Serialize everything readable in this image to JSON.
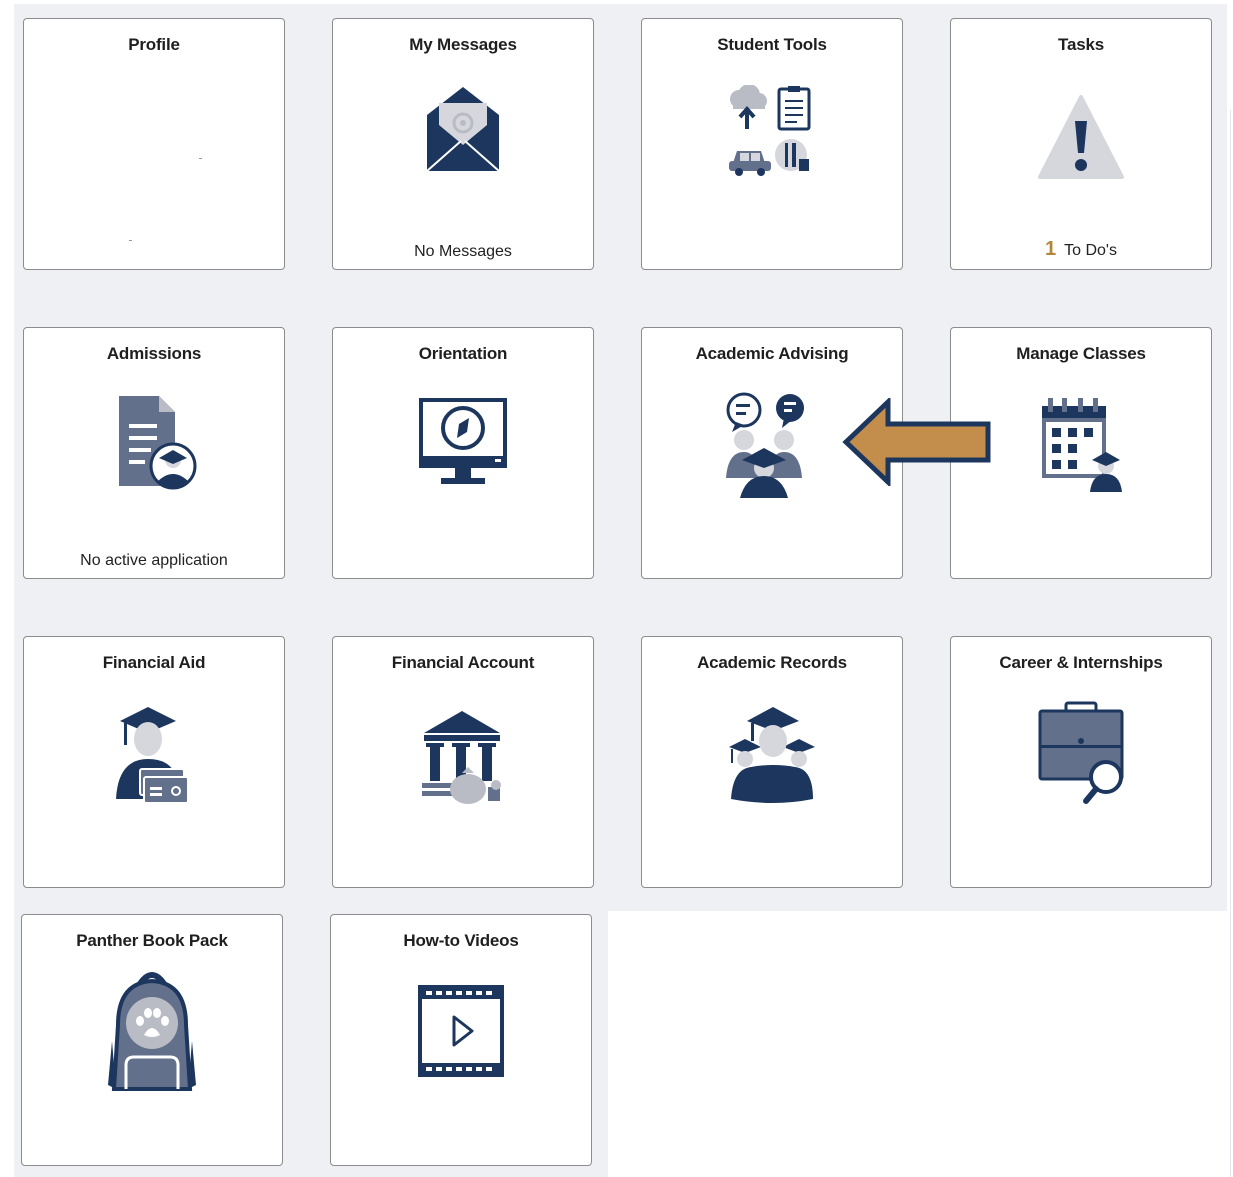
{
  "tiles": [
    {
      "title": "Profile",
      "footer": "",
      "icon": "profile-placeholder"
    },
    {
      "title": "My Messages",
      "footer": "No Messages",
      "icon": "envelope-icon"
    },
    {
      "title": "Student Tools",
      "footer": "",
      "icon": "student-tools-icon"
    },
    {
      "title": "Tasks",
      "count": "1",
      "footer": "To Do's",
      "icon": "warning-icon"
    },
    {
      "title": "Admissions",
      "footer": "No active application",
      "icon": "admissions-document-icon"
    },
    {
      "title": "Orientation",
      "footer": "",
      "icon": "monitor-compass-icon"
    },
    {
      "title": "Academic Advising",
      "footer": "",
      "icon": "advising-chat-icon"
    },
    {
      "title": "Manage Classes",
      "footer": "",
      "icon": "calendar-student-icon"
    },
    {
      "title": "Financial Aid",
      "footer": "",
      "icon": "graduate-card-icon"
    },
    {
      "title": "Financial Account",
      "footer": "",
      "icon": "bank-money-icon"
    },
    {
      "title": "Academic Records",
      "footer": "",
      "icon": "graduates-group-icon"
    },
    {
      "title": "Career & Internships",
      "footer": "",
      "icon": "briefcase-search-icon"
    },
    {
      "title": "Panther Book Pack",
      "footer": "",
      "icon": "backpack-paw-icon"
    },
    {
      "title": "How-to Videos",
      "footer": "",
      "icon": "film-play-icon"
    }
  ],
  "annotation": {
    "icon": "pointer-arrow-icon",
    "color": "#c38e4b",
    "border": "#1d365e"
  },
  "colors": {
    "navy": "#1d365e",
    "slate": "#63708c",
    "light": "#b9bcc4",
    "gold": "#b0873c",
    "background": "#eef0f4"
  }
}
